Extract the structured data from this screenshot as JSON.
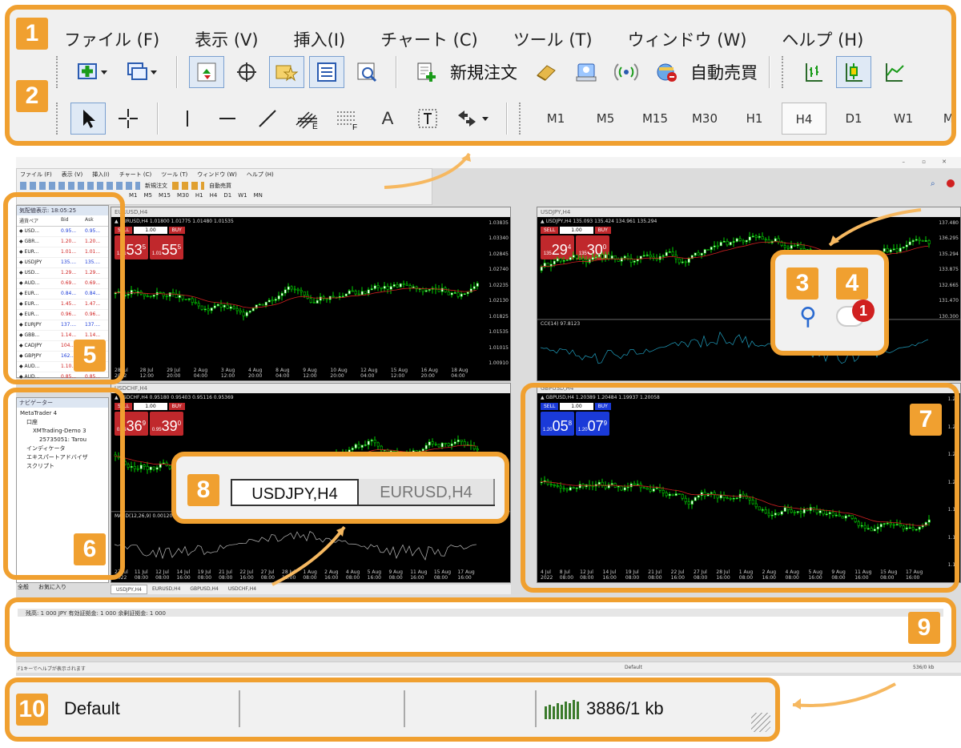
{
  "menu": [
    "ファイル (F)",
    "表示 (V)",
    "挿入(I)",
    "チャート (C)",
    "ツール (T)",
    "ウィンドウ (W)",
    "ヘルプ (H)"
  ],
  "toolbar": {
    "new_order": "新規注文",
    "auto_trade": "自動売買"
  },
  "draw_tools": {
    "text_tool": "A"
  },
  "timeframes": [
    "M1",
    "M5",
    "M15",
    "M30",
    "H1",
    "H4",
    "D1",
    "W1",
    "MN"
  ],
  "active_timeframe": "H4",
  "callout_numbers": [
    "1",
    "2",
    "3",
    "4",
    "5",
    "6",
    "7",
    "8",
    "9",
    "10"
  ],
  "notification_count": "1",
  "market_watch": {
    "title": "気配値表示: 18:05:25",
    "cols": [
      "通貨ペア",
      "Bid",
      "Ask"
    ],
    "rows": [
      [
        "USD...",
        "0.95...",
        "0.95..."
      ],
      [
        "GBR...",
        "1.20...",
        "1.20..."
      ],
      [
        "EUR...",
        "1.01...",
        "1.01..."
      ],
      [
        "USDJPY",
        "135....",
        "135...."
      ],
      [
        "USD...",
        "1.29...",
        "1.29..."
      ],
      [
        "AUD...",
        "0.69...",
        "0.69..."
      ],
      [
        "EUR...",
        "0.84...",
        "0.84..."
      ],
      [
        "EUR...",
        "1.45...",
        "1.47..."
      ],
      [
        "EUR...",
        "0.96...",
        "0.96..."
      ],
      [
        "EURJPY",
        "137....",
        "137...."
      ],
      [
        "GBB...",
        "1.14...",
        "1.14..."
      ],
      [
        "CADJPY",
        "104....",
        "104...."
      ],
      [
        "GBPJPY",
        "162....",
        "162...."
      ],
      [
        "AUD...",
        "1.10...",
        "1.10..."
      ],
      [
        "AUD...",
        "0.85...",
        "0.85..."
      ]
    ]
  },
  "navigator": {
    "title": "ナビゲーター",
    "root": "MetaTrader 4",
    "items": [
      "口座",
      "XMTrading-Demo 3",
      "25735051: Tarou",
      "インディケータ",
      "エキスパートアドバイザ",
      "スクリプト"
    ],
    "tabs": [
      "全般",
      "お気に入り"
    ]
  },
  "charts": [
    {
      "title": "EURUSD,H4",
      "info": "EURUSD,H4 1.01800 1.01775 1.01480 1.01535",
      "sell": "53",
      "sell_sup": "5",
      "sell_pre": "1.01",
      "buy": "55",
      "buy_sup": "5",
      "buy_pre": "1.01",
      "lot": "1.00",
      "yticks": [
        "1.03835",
        "1.03340",
        "1.02845",
        "1.02740",
        "1.02235",
        "1.02130",
        "1.01825",
        "1.01535",
        "1.01015",
        "1.00910"
      ],
      "xticks": [
        "28 Jul 2022",
        "28 Jul 12:00",
        "29 Jul 20:00",
        "2 Aug 04:00",
        "3 Aug 12:00",
        "4 Aug 20:00",
        "8 Aug 04:00",
        "9 Aug 12:00",
        "10 Aug 20:00",
        "12 Aug 04:00",
        "15 Aug 12:00",
        "16 Aug 20:00",
        "18 Aug 04:00"
      ]
    },
    {
      "title": "USDJPY,H4",
      "info": "USDJPY,H4 135.093 135.424 134.961 135.294",
      "sell": "29",
      "sell_sup": "4",
      "sell_pre": "135",
      "buy": "30",
      "buy_sup": "0",
      "buy_pre": "135",
      "lot": "1.00",
      "indicator": "CCI(14) 97.8123",
      "yticks": [
        "137.480",
        "136.295",
        "135.294",
        "133.875",
        "132.665",
        "131.470",
        "130.300"
      ],
      "ind_ticks": [
        "101.5666",
        "100",
        "0",
        "-100",
        "-423.7886"
      ]
    },
    {
      "title": "USDCHF,H4",
      "info": "USDCHF,H4 0.95180 0.95403 0.95116 0.95369",
      "sell": "36",
      "sell_sup": "9",
      "sell_pre": "0.95",
      "buy": "39",
      "buy_sup": "0",
      "buy_pre": "0.95",
      "lot": "1.00",
      "indicator": "MACD(12,26,9) 0.001209 0.000921",
      "xticks": [
        "27 Jul 2022",
        "11 Jul 08:00",
        "12 Jul 08:00",
        "14 Jul 16:00",
        "19 Jul 08:00",
        "21 Jul 08:00",
        "22 Jul 16:00",
        "27 Jul 08:00",
        "28 Jul 16:00",
        "1 Aug 08:00",
        "2 Aug 16:00",
        "4 Aug 08:00",
        "5 Aug 16:00",
        "9 Aug 08:00",
        "11 Aug 16:00",
        "15 Aug 08:00",
        "17 Aug 16:00"
      ]
    },
    {
      "title": "GBPUSD,H4",
      "info": "GBPUSD,H4 1.20389 1.20484 1.19937 1.20058",
      "sell": "05",
      "sell_sup": "8",
      "sell_pre": "1.20",
      "buy": "07",
      "buy_sup": "9",
      "buy_pre": "1.20",
      "lot": "1.00",
      "yticks": [
        "1.23",
        "1.22",
        "1.21",
        "1.20",
        "1.19",
        "1.18",
        "1.17"
      ],
      "xticks": [
        "4 Jul 2022",
        "8 Jul 08:00",
        "12 Jul 08:00",
        "14 Jul 16:00",
        "19 Jul 08:00",
        "21 Jul 08:00",
        "22 Jul 16:00",
        "27 Jul 08:00",
        "28 Jul 16:00",
        "1 Aug 08:00",
        "2 Aug 16:00",
        "4 Aug 08:00",
        "5 Aug 16:00",
        "9 Aug 08:00",
        "11 Aug 16:00",
        "15 Aug 08:00",
        "17 Aug 16:00"
      ]
    }
  ],
  "chart_tabs": [
    "USDJPY,H4",
    "EURUSD,H4",
    "GBPUSD,H4",
    "USDCHF,H4"
  ],
  "chart_tabs_zoom": [
    "USDJPY,H4",
    "EURUSD,H4"
  ],
  "terminal": {
    "text": "残高: 1 000 JPY  有効証拠金: 1 000  余剰証拠金: 1 000"
  },
  "statusbar": {
    "help": "F1キーでヘルプが表示されます",
    "profile": "Default",
    "traffic": "536/0 kb"
  },
  "statusbar_zoom": {
    "profile": "Default",
    "traffic": "3886/1 kb"
  },
  "buttons": {
    "sell": "SELL",
    "buy": "BUY"
  },
  "colors": {
    "callout": "#f0a030",
    "up_candle": "#00d000",
    "ma_line": "#d02020",
    "sell_red": "#c0282c",
    "buy_red": "#c0282c",
    "sell_blue": "#1a3ad8",
    "buy_blue": "#1a3ad8"
  }
}
